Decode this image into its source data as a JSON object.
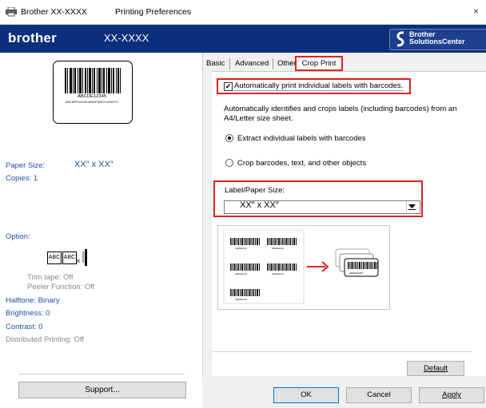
{
  "window": {
    "app_title": "Brother  XX-XXXX",
    "dialog_title": "Printing Preferences",
    "close_glyph": "×"
  },
  "brand": {
    "logo": "brother",
    "model": "XX-XXXX",
    "solutions_line1": "Brother",
    "solutions_line2": "SolutionsCenter",
    "color": "#0b2f7a"
  },
  "preview": {
    "label_code": "ABCDE12345",
    "label_alpha": "ABCDEFGHIJKLMNOPQRSTUVWXYZ"
  },
  "summary": {
    "paper_size_label": "Paper Size:",
    "paper_size_value": "XX″ x XX″",
    "copies": "Copies: 1",
    "option_label": "Option:",
    "abc1": "ABC",
    "abc2": "ABC",
    "x_mark": "x",
    "trim_tape": "Trim tape: Off",
    "peeler": "Peeler Function: Off",
    "halftone": "Halftone: Binary",
    "brightness": "Brightness:  0",
    "contrast": "Contrast:  0",
    "distributed": "Distributed Printing: Off"
  },
  "tabs": [
    "Basic",
    "Advanced",
    "Other",
    "Crop Print"
  ],
  "crop": {
    "auto_checkbox": "Automatically print individual labels with barcodes.",
    "description": "Automatically identifies and crops labels (including barcodes) from an A4/Letter size sheet.",
    "radio1": "Extract individual labels with barcodes",
    "radio2": "Crop barcodes, text, and other objects",
    "size_label": "Label/Paper Size:",
    "size_value": "XX″ x XX″",
    "sheet_code": "ABCDE1234",
    "stack_code": "ABCDE1234"
  },
  "buttons": {
    "support": "Support...",
    "default": "Default",
    "ok": "OK",
    "cancel": "Cancel",
    "apply": "Apply"
  },
  "colors": {
    "highlight": "#e02020",
    "accent_text": "#1f4f9f",
    "arrow": "#e02020"
  }
}
